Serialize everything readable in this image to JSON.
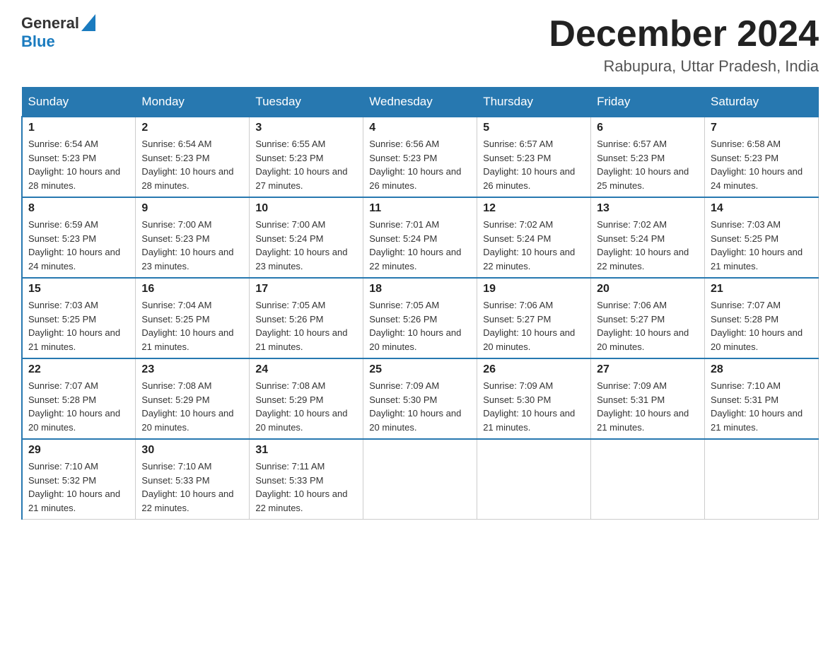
{
  "header": {
    "logo": {
      "general": "General",
      "blue": "Blue"
    },
    "month_title": "December 2024",
    "location": "Rabupura, Uttar Pradesh, India"
  },
  "weekdays": [
    "Sunday",
    "Monday",
    "Tuesday",
    "Wednesday",
    "Thursday",
    "Friday",
    "Saturday"
  ],
  "weeks": [
    [
      {
        "day": "1",
        "sunrise": "6:54 AM",
        "sunset": "5:23 PM",
        "daylight": "10 hours and 28 minutes."
      },
      {
        "day": "2",
        "sunrise": "6:54 AM",
        "sunset": "5:23 PM",
        "daylight": "10 hours and 28 minutes."
      },
      {
        "day": "3",
        "sunrise": "6:55 AM",
        "sunset": "5:23 PM",
        "daylight": "10 hours and 27 minutes."
      },
      {
        "day": "4",
        "sunrise": "6:56 AM",
        "sunset": "5:23 PM",
        "daylight": "10 hours and 26 minutes."
      },
      {
        "day": "5",
        "sunrise": "6:57 AM",
        "sunset": "5:23 PM",
        "daylight": "10 hours and 26 minutes."
      },
      {
        "day": "6",
        "sunrise": "6:57 AM",
        "sunset": "5:23 PM",
        "daylight": "10 hours and 25 minutes."
      },
      {
        "day": "7",
        "sunrise": "6:58 AM",
        "sunset": "5:23 PM",
        "daylight": "10 hours and 24 minutes."
      }
    ],
    [
      {
        "day": "8",
        "sunrise": "6:59 AM",
        "sunset": "5:23 PM",
        "daylight": "10 hours and 24 minutes."
      },
      {
        "day": "9",
        "sunrise": "7:00 AM",
        "sunset": "5:23 PM",
        "daylight": "10 hours and 23 minutes."
      },
      {
        "day": "10",
        "sunrise": "7:00 AM",
        "sunset": "5:24 PM",
        "daylight": "10 hours and 23 minutes."
      },
      {
        "day": "11",
        "sunrise": "7:01 AM",
        "sunset": "5:24 PM",
        "daylight": "10 hours and 22 minutes."
      },
      {
        "day": "12",
        "sunrise": "7:02 AM",
        "sunset": "5:24 PM",
        "daylight": "10 hours and 22 minutes."
      },
      {
        "day": "13",
        "sunrise": "7:02 AM",
        "sunset": "5:24 PM",
        "daylight": "10 hours and 22 minutes."
      },
      {
        "day": "14",
        "sunrise": "7:03 AM",
        "sunset": "5:25 PM",
        "daylight": "10 hours and 21 minutes."
      }
    ],
    [
      {
        "day": "15",
        "sunrise": "7:03 AM",
        "sunset": "5:25 PM",
        "daylight": "10 hours and 21 minutes."
      },
      {
        "day": "16",
        "sunrise": "7:04 AM",
        "sunset": "5:25 PM",
        "daylight": "10 hours and 21 minutes."
      },
      {
        "day": "17",
        "sunrise": "7:05 AM",
        "sunset": "5:26 PM",
        "daylight": "10 hours and 21 minutes."
      },
      {
        "day": "18",
        "sunrise": "7:05 AM",
        "sunset": "5:26 PM",
        "daylight": "10 hours and 20 minutes."
      },
      {
        "day": "19",
        "sunrise": "7:06 AM",
        "sunset": "5:27 PM",
        "daylight": "10 hours and 20 minutes."
      },
      {
        "day": "20",
        "sunrise": "7:06 AM",
        "sunset": "5:27 PM",
        "daylight": "10 hours and 20 minutes."
      },
      {
        "day": "21",
        "sunrise": "7:07 AM",
        "sunset": "5:28 PM",
        "daylight": "10 hours and 20 minutes."
      }
    ],
    [
      {
        "day": "22",
        "sunrise": "7:07 AM",
        "sunset": "5:28 PM",
        "daylight": "10 hours and 20 minutes."
      },
      {
        "day": "23",
        "sunrise": "7:08 AM",
        "sunset": "5:29 PM",
        "daylight": "10 hours and 20 minutes."
      },
      {
        "day": "24",
        "sunrise": "7:08 AM",
        "sunset": "5:29 PM",
        "daylight": "10 hours and 20 minutes."
      },
      {
        "day": "25",
        "sunrise": "7:09 AM",
        "sunset": "5:30 PM",
        "daylight": "10 hours and 20 minutes."
      },
      {
        "day": "26",
        "sunrise": "7:09 AM",
        "sunset": "5:30 PM",
        "daylight": "10 hours and 21 minutes."
      },
      {
        "day": "27",
        "sunrise": "7:09 AM",
        "sunset": "5:31 PM",
        "daylight": "10 hours and 21 minutes."
      },
      {
        "day": "28",
        "sunrise": "7:10 AM",
        "sunset": "5:31 PM",
        "daylight": "10 hours and 21 minutes."
      }
    ],
    [
      {
        "day": "29",
        "sunrise": "7:10 AM",
        "sunset": "5:32 PM",
        "daylight": "10 hours and 21 minutes."
      },
      {
        "day": "30",
        "sunrise": "7:10 AM",
        "sunset": "5:33 PM",
        "daylight": "10 hours and 22 minutes."
      },
      {
        "day": "31",
        "sunrise": "7:11 AM",
        "sunset": "5:33 PM",
        "daylight": "10 hours and 22 minutes."
      },
      null,
      null,
      null,
      null
    ]
  ],
  "labels": {
    "sunrise_prefix": "Sunrise: ",
    "sunset_prefix": "Sunset: ",
    "daylight_prefix": "Daylight: "
  }
}
